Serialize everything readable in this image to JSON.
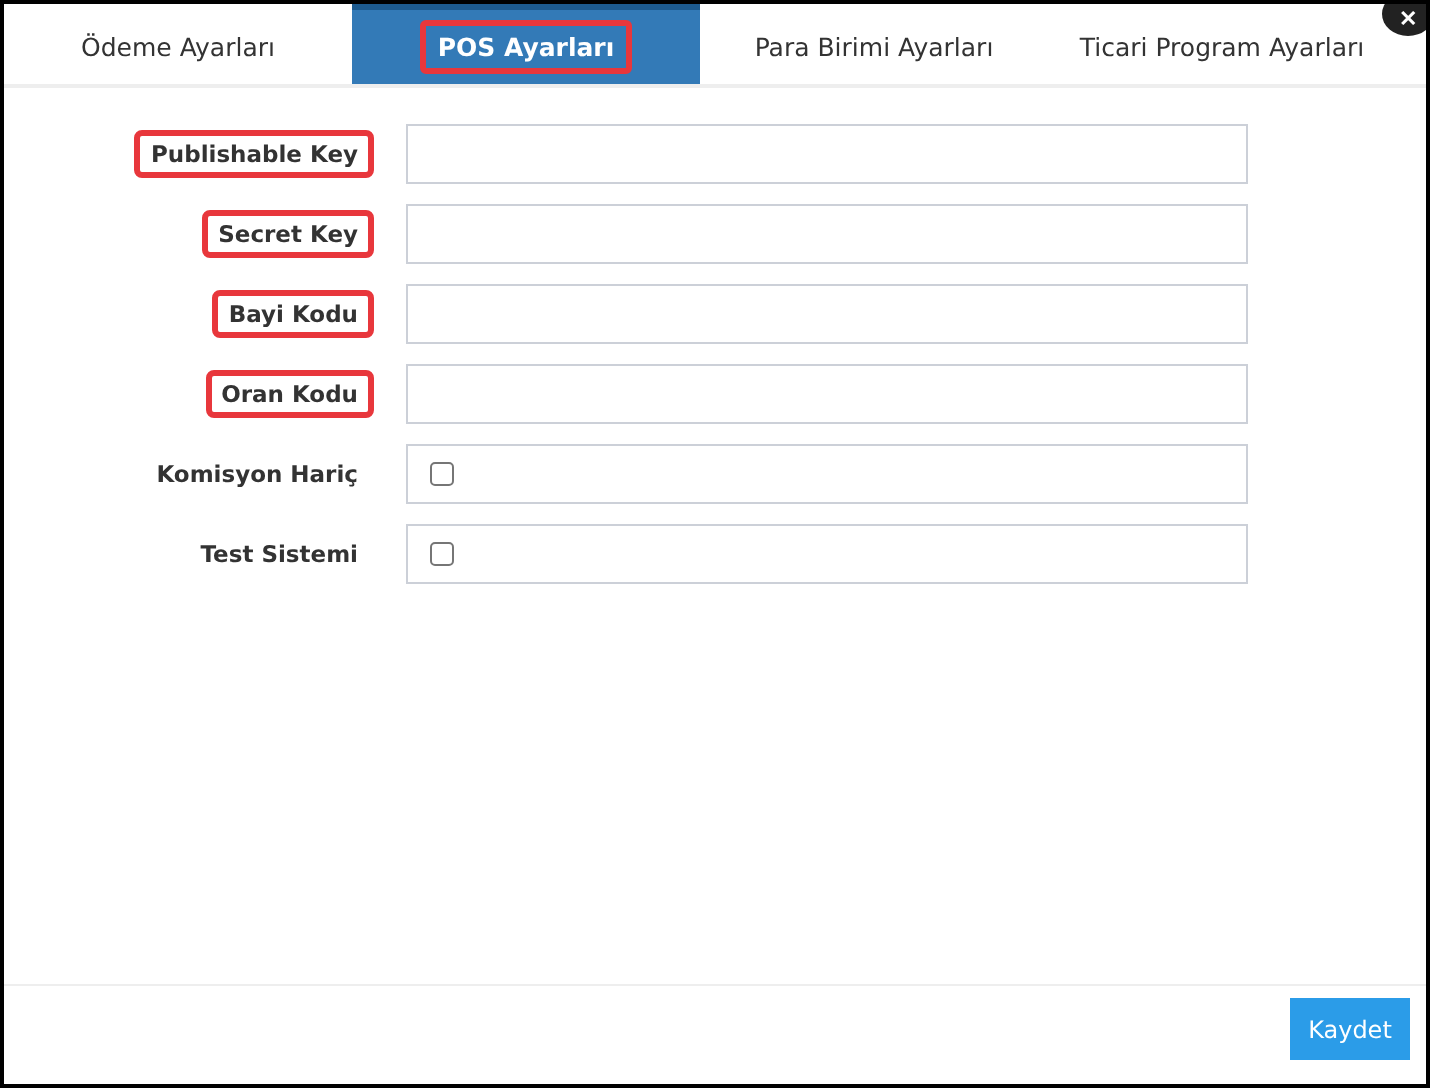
{
  "close_button": {
    "label": "✕"
  },
  "tabs": [
    {
      "label": "Ödeme Ayarları",
      "selected": false,
      "highlighted": false
    },
    {
      "label": "POS Ayarları",
      "selected": true,
      "highlighted": true
    },
    {
      "label": "Para Birimi Ayarları",
      "selected": false,
      "highlighted": false
    },
    {
      "label": "Ticari Program Ayarları",
      "selected": false,
      "highlighted": false
    }
  ],
  "fields": [
    {
      "label": "Publishable Key",
      "kind": "text",
      "highlighted": true
    },
    {
      "label": "Secret Key",
      "kind": "text",
      "highlighted": true
    },
    {
      "label": "Bayi Kodu",
      "kind": "text",
      "highlighted": true
    },
    {
      "label": "Oran Kodu",
      "kind": "text",
      "highlighted": true
    },
    {
      "label": "Komisyon Hariç",
      "kind": "checkbox",
      "checked": false,
      "highlighted": false
    },
    {
      "label": "Test Sistemi",
      "kind": "checkbox",
      "checked": false,
      "highlighted": false
    }
  ],
  "save_button": {
    "label": "Kaydet"
  }
}
